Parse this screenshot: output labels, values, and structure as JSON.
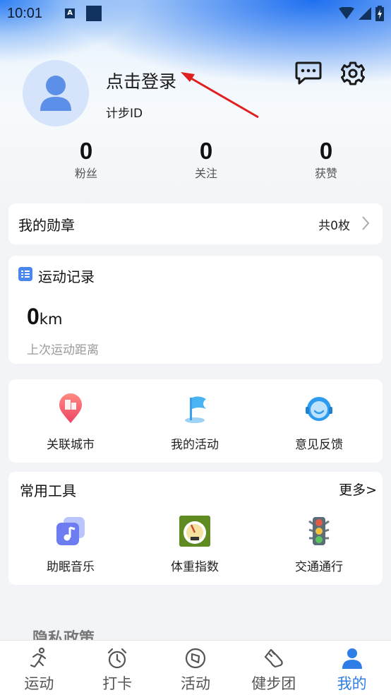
{
  "status_bar": {
    "time": "10:01",
    "notif_a": "A"
  },
  "profile": {
    "login_text": "点击登录",
    "id_label": "计步ID"
  },
  "stats": [
    {
      "value": "0",
      "label": "粉丝"
    },
    {
      "value": "0",
      "label": "关注"
    },
    {
      "value": "0",
      "label": "获赞"
    }
  ],
  "medal": {
    "title": "我的勋章",
    "count": "共0枚"
  },
  "record": {
    "title": "运动记录",
    "distance": "0",
    "unit": "km",
    "subtitle": "上次运动距离"
  },
  "links": [
    {
      "label": "关联城市",
      "icon": "map-pin-icon"
    },
    {
      "label": "我的活动",
      "icon": "flag-icon"
    },
    {
      "label": "意见反馈",
      "icon": "headset-icon"
    }
  ],
  "tools": {
    "title": "常用工具",
    "more": "更多>",
    "items": [
      {
        "label": "助眠音乐",
        "icon": "music-note-icon"
      },
      {
        "label": "体重指数",
        "icon": "scale-icon"
      },
      {
        "label": "交通通行",
        "icon": "traffic-light-icon"
      }
    ]
  },
  "privacy": "隐私政策",
  "tabbar": [
    {
      "label": "运动",
      "icon": "running-icon",
      "active": false
    },
    {
      "label": "打卡",
      "icon": "alarm-clock-icon",
      "active": false
    },
    {
      "label": "活动",
      "icon": "compass-icon",
      "active": false
    },
    {
      "label": "健步团",
      "icon": "shoe-icon",
      "active": false
    },
    {
      "label": "我的",
      "icon": "person-icon",
      "active": true
    }
  ],
  "colors": {
    "accent": "#2f7de6",
    "page_bg": "#f2f4f7",
    "annotation_arrow": "#e02020"
  }
}
